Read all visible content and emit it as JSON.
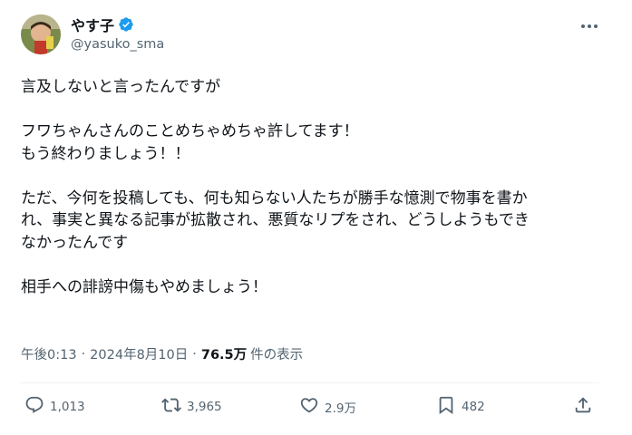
{
  "author": {
    "display_name": "やす子",
    "handle": "@yasuko_sma",
    "verified_color": "#1d9bf0"
  },
  "body": {
    "line1": "言及しないと言ったんですが",
    "line2": "フワちゃんさんのことめちゃめちゃ許してます！",
    "line3": "もう終わりましょう！！",
    "line4": "ただ、今何を投稿しても、何も知らない人たちが勝手な憶測で物事を書か",
    "line5": "れ、事実と異なる記事が拡散され、悪質なリプをされ、どうしようもでき",
    "line6": "なかったんです",
    "line7": "相手への誹謗中傷もやめましょう！"
  },
  "meta": {
    "time": "午後0:13",
    "separator": "·",
    "date": "2024年8月10日",
    "views_count": "76.5万",
    "views_label": "件の表示"
  },
  "actions": {
    "replies": "1,013",
    "reposts": "3,965",
    "likes": "2.9万",
    "bookmarks": "482"
  },
  "icons": [
    "avatar",
    "verified-icon",
    "more-icon",
    "reply-icon",
    "repost-icon",
    "like-icon",
    "bookmark-icon",
    "share-icon"
  ]
}
